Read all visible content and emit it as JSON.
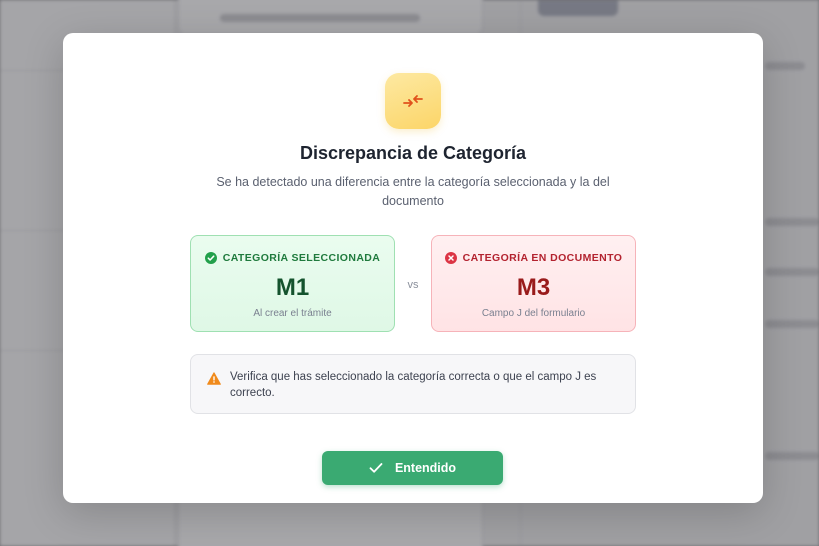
{
  "dialog": {
    "icon": "compare-arrows-icon",
    "title": "Discrepancia de Categoría",
    "subtitle": "Se ha detectado una diferencia entre la categoría seleccionada y la del documento",
    "selected": {
      "icon": "check-circle-icon",
      "label": "CATEGORÍA SELECCIONADA",
      "value": "M1",
      "note": "Al crear el trámite"
    },
    "vs_label": "vs",
    "document": {
      "icon": "x-circle-icon",
      "label": "CATEGORÍA EN DOCUMENTO",
      "value": "M3",
      "note": "Campo J del formulario"
    },
    "warning": {
      "icon": "warning-triangle-icon",
      "text": "Verifica que has seleccionado la categoría correcta o que el campo J es correcto."
    },
    "confirm_button": {
      "icon": "check-icon",
      "label": "Entendido"
    }
  },
  "colors": {
    "success": "#3aaa72",
    "danger": "#b3232f",
    "warning": "#f08a1c",
    "icon_tile": "#fcd568"
  }
}
